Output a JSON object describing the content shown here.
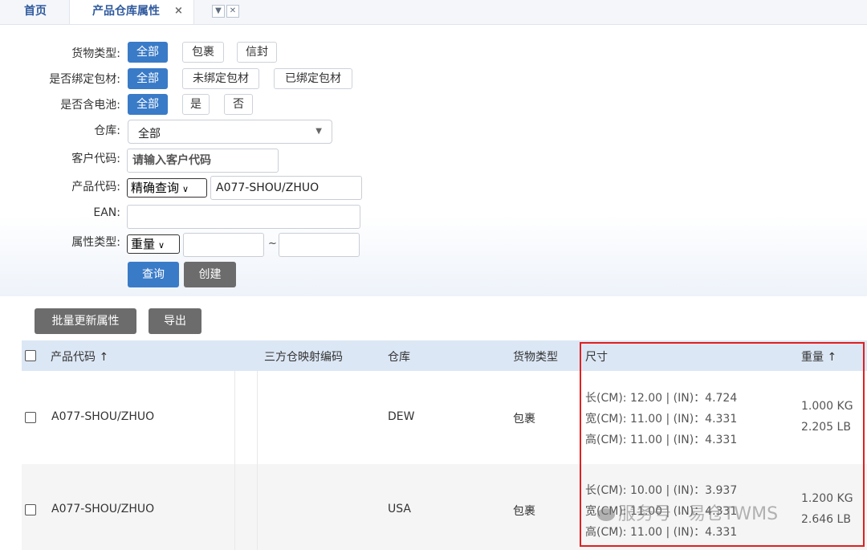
{
  "tabs": {
    "home": "首页",
    "active": "产品仓库属性",
    "close": "×"
  },
  "filters": {
    "cargo_type": {
      "label": "货物类型:",
      "options": [
        "全部",
        "包裹",
        "信封"
      ],
      "selected": "全部"
    },
    "bound_packaging": {
      "label": "是否绑定包材:",
      "options": [
        "全部",
        "未绑定包材",
        "已绑定包材"
      ],
      "selected": "全部"
    },
    "has_battery": {
      "label": "是否含电池:",
      "options": [
        "全部",
        "是",
        "否"
      ],
      "selected": "全部"
    },
    "warehouse": {
      "label": "仓库:",
      "value": "全部"
    },
    "customer_code": {
      "label": "客户代码:",
      "placeholder": "请输入客户代码"
    },
    "product_code": {
      "label": "产品代码:",
      "mode": "精确查询",
      "value": "A077-SHOU/ZHUO"
    },
    "ean": {
      "label": "EAN:",
      "value": ""
    },
    "attr_type": {
      "label": "属性类型:",
      "mode": "重量",
      "sep": "~"
    }
  },
  "buttons": {
    "query": "查询",
    "create": "创建",
    "batch_update": "批量更新属性",
    "export": "导出"
  },
  "table": {
    "headers": [
      "产品代码 ↑",
      "三方仓映射编码",
      "仓库",
      "货物类型",
      "尺寸",
      "重量 ↑"
    ],
    "rows": [
      {
        "product_code": "A077-SHOU/ZHUO",
        "mapping_code": "",
        "warehouse": "DEW",
        "cargo_type": "包裹",
        "dims": [
          "长(CM): 12.00  |  (IN)：4.724",
          "宽(CM): 11.00  |  (IN)：4.331",
          "高(CM): 11.00  |  (IN)：4.331"
        ],
        "weight": [
          "1.000 KG",
          "2.205 LB"
        ]
      },
      {
        "product_code": "A077-SHOU/ZHUO",
        "mapping_code": "",
        "warehouse": "USA",
        "cargo_type": "包裹",
        "dims": [
          "长(CM): 10.00  |  (IN)：3.937",
          "宽(CM): 11.00  |  (IN)：4.331",
          "高(CM): 11.00  |  (IN)：4.331"
        ],
        "weight": [
          "1.200 KG",
          "2.646 LB"
        ]
      }
    ]
  },
  "watermark": "服务号 · 易仓TWMS"
}
